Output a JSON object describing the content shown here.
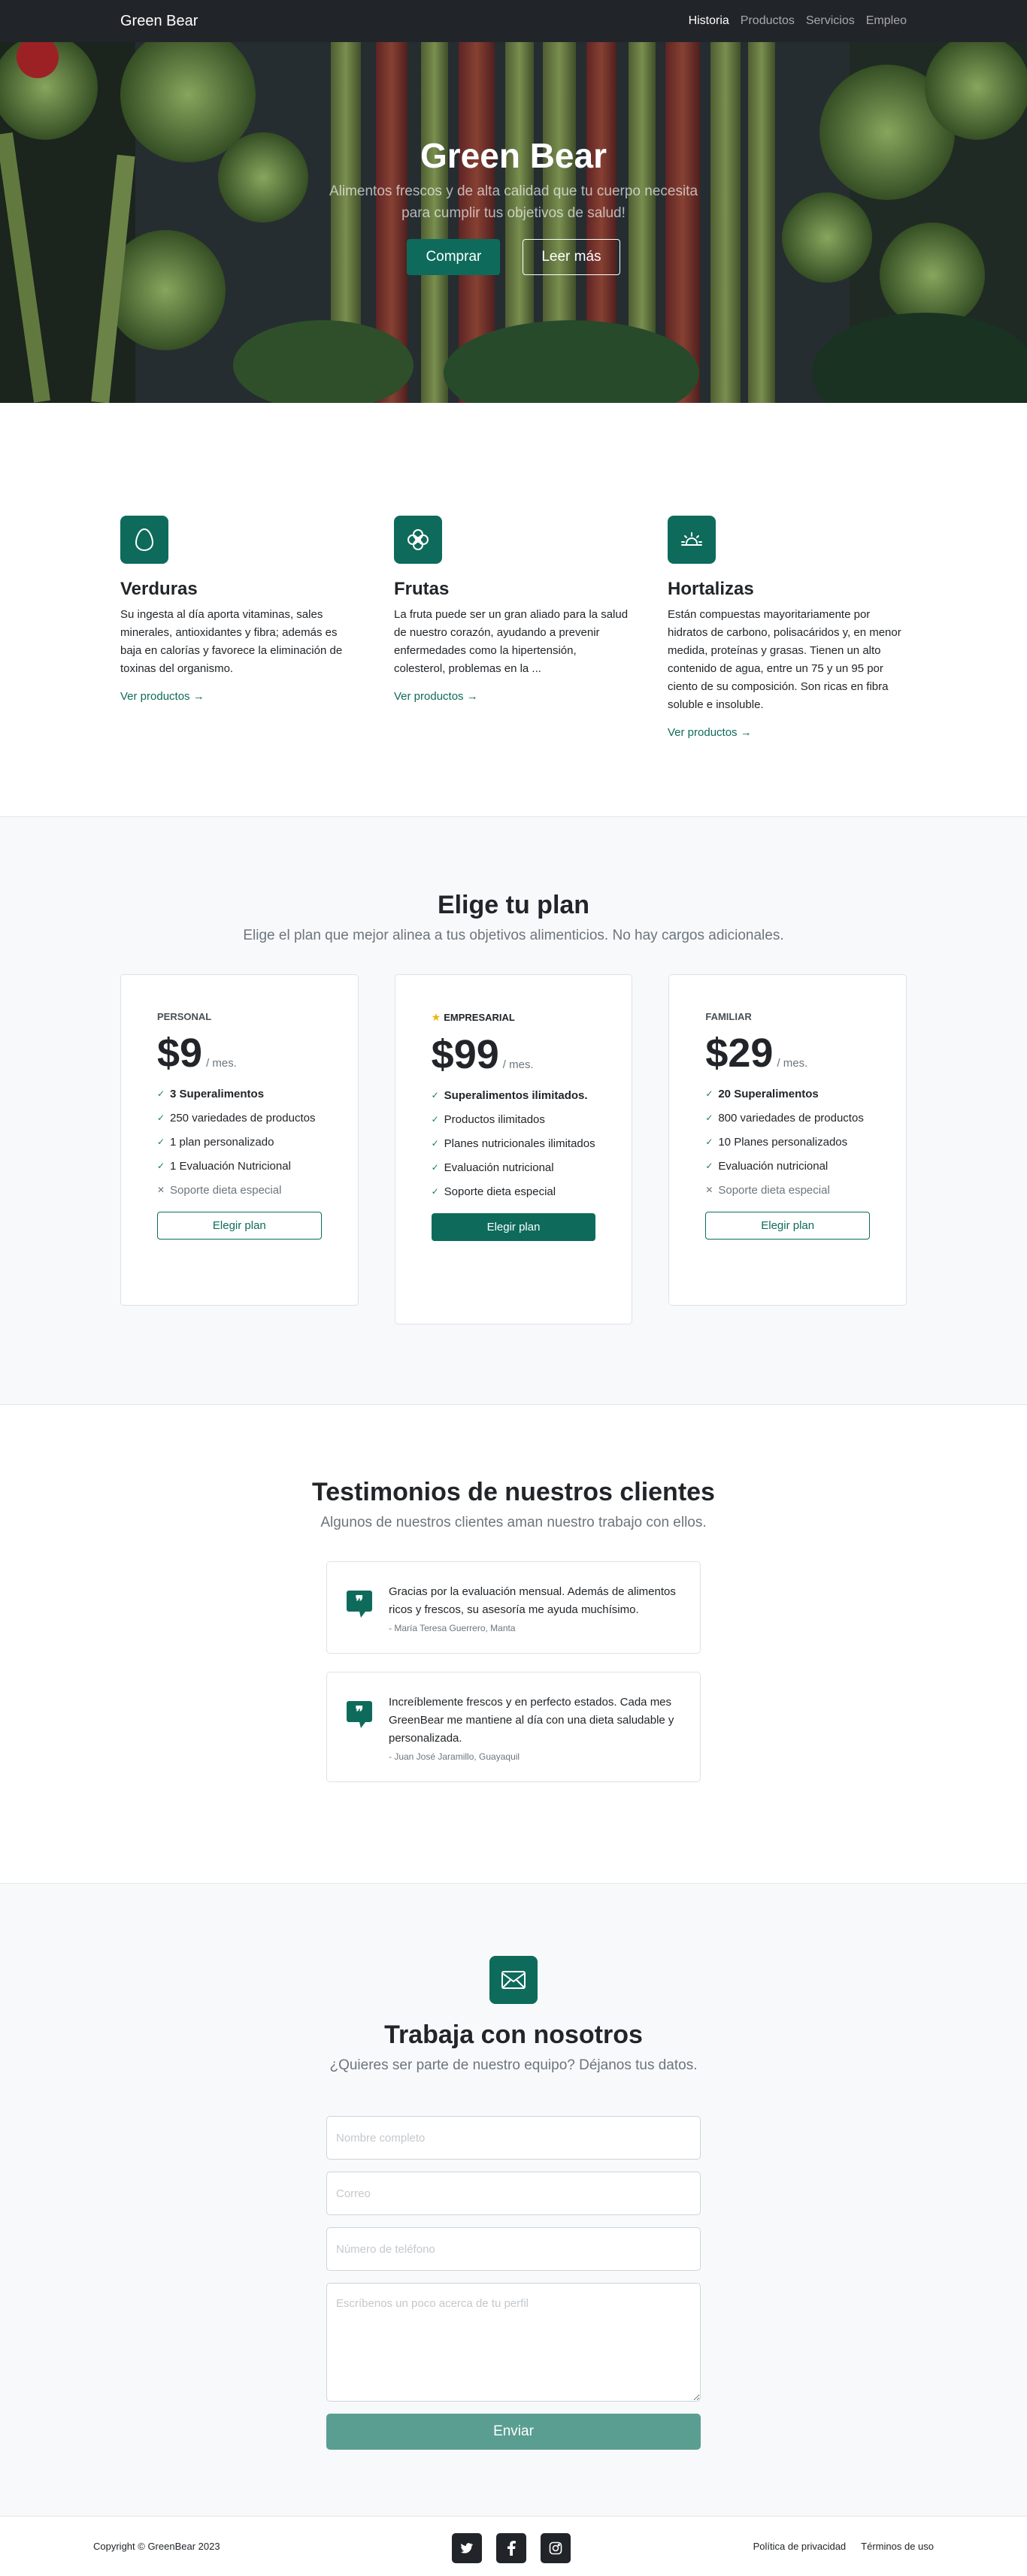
{
  "nav": {
    "brand": "Green Bear",
    "links": [
      "Historia",
      "Productos",
      "Servicios",
      "Empleo"
    ]
  },
  "hero": {
    "title": "Green Bear",
    "subtitle": "Alimentos frescos y de alta calidad que tu cuerpo necesita para cumplir tus objetivos de salud!",
    "buy_label": "Comprar",
    "read_more_label": "Leer más"
  },
  "features": [
    {
      "title": "Verduras",
      "text": "Su ingesta al día aporta vitaminas, sales minerales, antioxidantes y fibra; además es baja en calorías y favorece la eliminación de toxinas del organismo.",
      "link": "Ver productos →",
      "icon": "egg-icon"
    },
    {
      "title": "Frutas",
      "text": "La fruta puede ser un gran aliado para la salud de nuestro corazón, ayudando a prevenir enfermedades como la hipertensión, colesterol, problemas en la ...",
      "link": "Ver productos →",
      "icon": "flower-icon"
    },
    {
      "title": "Hortalizas",
      "text": "Están compuestas mayoritariamente por hidratos de carbono, polisacáridos y, en menor medida, proteínas y grasas. Tienen un alto contenido de agua, entre un 75 y un 95 por ciento de su composición. Son ricas en fibra soluble e insoluble.",
      "link": "Ver productos →",
      "icon": "sunrise-icon"
    }
  ],
  "pricing": {
    "title": "Elige tu plan",
    "subtitle": "Elige el plan que mejor alinea a tus objetivos alimenticios. No hay cargos adicionales.",
    "plans": [
      {
        "label": "PERSONAL",
        "price": "$9",
        "period": "/ mes.",
        "features": [
          "3 Superalimentos",
          "250 variedades de productos",
          "1 plan personalizado",
          "1 Evaluación Nutricional",
          "Soporte dieta especial"
        ],
        "button": "Elegir plan"
      },
      {
        "label": "EMPRESARIAL",
        "price": "$99",
        "period": "/ mes.",
        "features": [
          "Superalimentos ilimitados.",
          "Productos ilimitados",
          "Planes nutricionales ilimitados",
          "Evaluación nutricional",
          "Soporte dieta especial"
        ],
        "button": "Elegir plan"
      },
      {
        "label": "FAMILIAR",
        "price": "$29",
        "period": "/ mes.",
        "features": [
          "20 Superalimentos",
          "800 variedades de productos",
          "10 Planes personalizados",
          "Evaluación nutricional",
          "Soporte dieta especial"
        ],
        "button": "Elegir plan"
      }
    ]
  },
  "testimonials": {
    "title": "Testimonios de nuestros clientes",
    "subtitle": "Algunos de nuestros clientes aman nuestro trabajo con ellos.",
    "items": [
      {
        "quote": "Gracias por la evaluación mensual. Además de alimentos ricos y frescos, su asesoría me ayuda muchísimo.",
        "author": "- María Teresa Guerrero, Manta"
      },
      {
        "quote": "Increíblemente frescos y en perfecto estados. Cada mes GreenBear me mantiene al día con una dieta saludable y personalizada.",
        "author": "- Juan José Jaramillo, Guayaquil"
      }
    ]
  },
  "work": {
    "title": "Trabaja con nosotros",
    "subtitle": "¿Quieres ser parte de nuestro equipo? Déjanos tus datos.",
    "name_placeholder": "Nombre completo",
    "email_placeholder": "Correo",
    "phone_placeholder": "Número de teléfono",
    "about_placeholder": "Escríbenos un poco acerca de tu perfil",
    "submit_label": "Enviar"
  },
  "footer": {
    "copyright": "Copyright © GreenBear 2023",
    "privacy": "Política de privacidad",
    "terms": "Términos de uso",
    "socials": [
      "twitter-icon",
      "facebook-icon",
      "instagram-icon"
    ]
  },
  "colors": {
    "primary": "#0e6b5b",
    "dark": "#212529",
    "muted": "#6c757d",
    "gray_bg": "#f8f9fa",
    "submit_disabled": "#5a9e91",
    "star": "#f0b400"
  }
}
